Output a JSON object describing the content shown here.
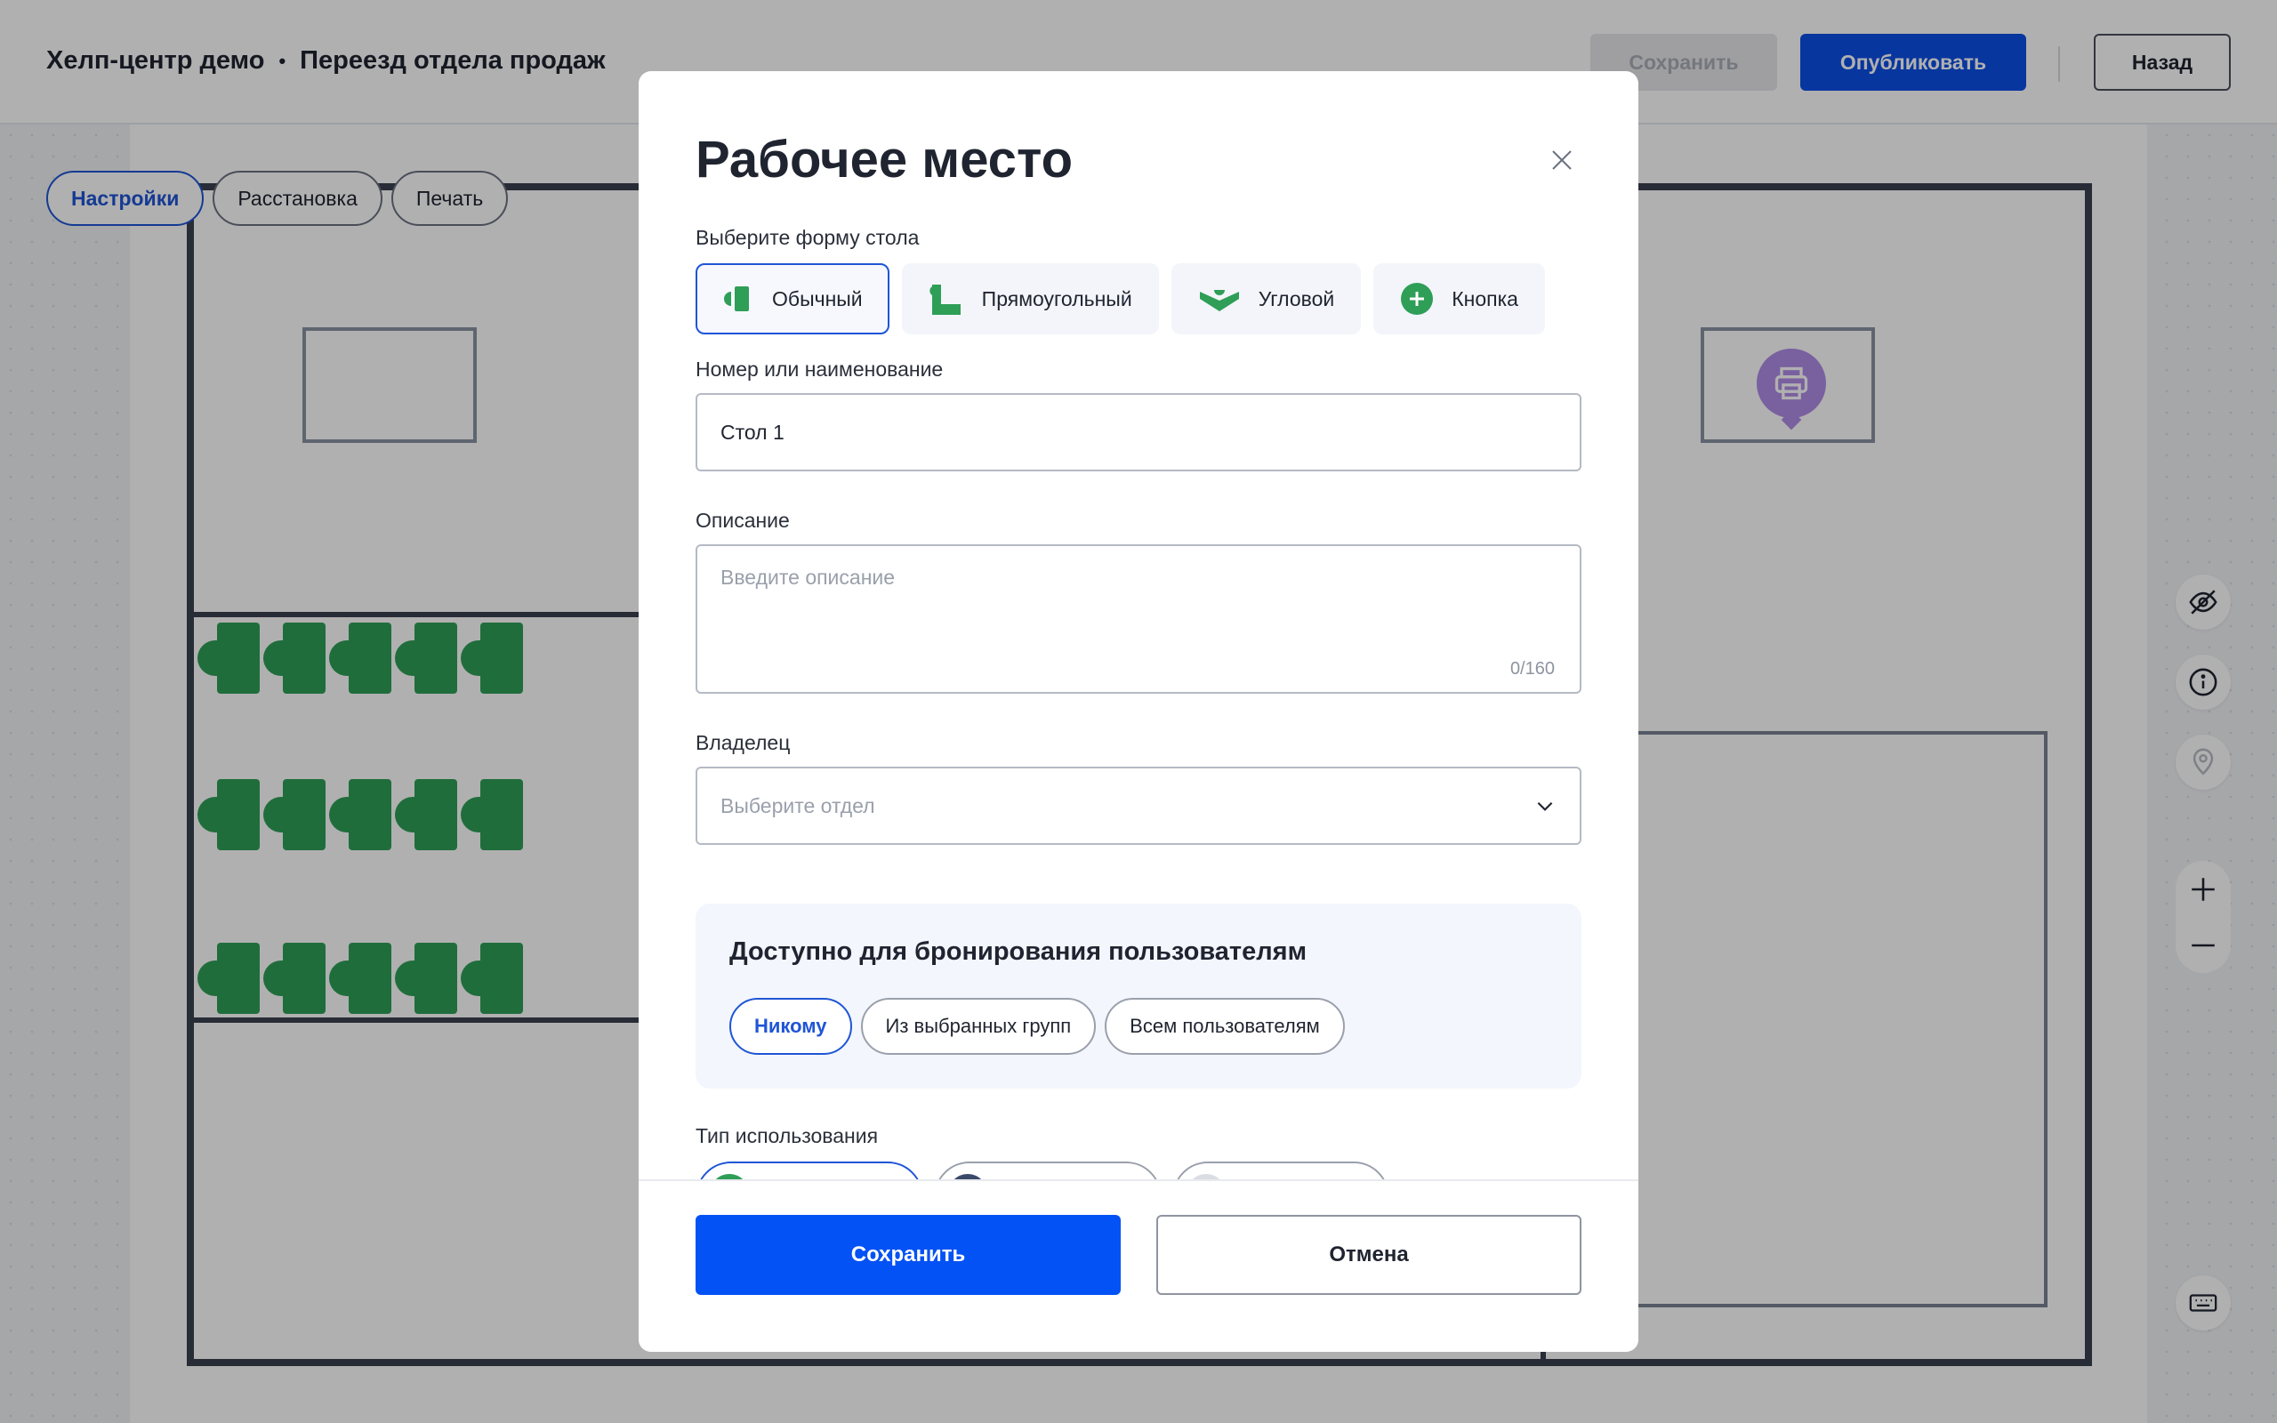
{
  "header": {
    "breadcrumb_root": "Хелп-центр демо",
    "breadcrumb_separator": "•",
    "breadcrumb_current": "Переезд отдела продаж",
    "save_label": "Сохранить",
    "publish_label": "Опубликовать",
    "back_label": "Назад"
  },
  "canvas": {
    "mode_tabs": [
      {
        "label": "Настройки",
        "active": true
      },
      {
        "label": "Расстановка",
        "active": false
      },
      {
        "label": "Печать",
        "active": false
      }
    ],
    "desk_color": "#2f9e57",
    "printer_color": "#b08ce6",
    "tools": [
      "eye-off-icon",
      "info-icon",
      "map-pin-icon",
      "zoom-in-icon",
      "zoom-out-icon",
      "keyboard-icon"
    ]
  },
  "modal": {
    "title": "Рабочее место",
    "shape_label": "Выберите форму стола",
    "shapes": [
      {
        "label": "Обычный",
        "icon": "desk-regular-icon",
        "active": true
      },
      {
        "label": "Прямоугольный",
        "icon": "desk-rectangular-icon",
        "active": false
      },
      {
        "label": "Угловой",
        "icon": "desk-corner-icon",
        "active": false
      },
      {
        "label": "Кнопка",
        "icon": "plus-circle-icon",
        "active": false
      }
    ],
    "name_label": "Номер или наименование",
    "name_value": "Стол 1",
    "description_label": "Описание",
    "description_placeholder": "Введите описание",
    "description_counter": "0/160",
    "owner_label": "Владелец",
    "owner_placeholder": "Выберите отдел",
    "booking_title": "Доступно для бронирования пользователям",
    "booking_options": [
      {
        "label": "Никому",
        "active": true
      },
      {
        "label": "Из выбранных групп",
        "active": false
      },
      {
        "label": "Всем пользователям",
        "active": false
      }
    ],
    "usage_label": "Тип использования",
    "usage_colors": [
      "#2f9e57",
      "#3b4a6b",
      "#dadde3"
    ],
    "save_label": "Сохранить",
    "cancel_label": "Отмена",
    "accent_color": "#0352f5"
  }
}
